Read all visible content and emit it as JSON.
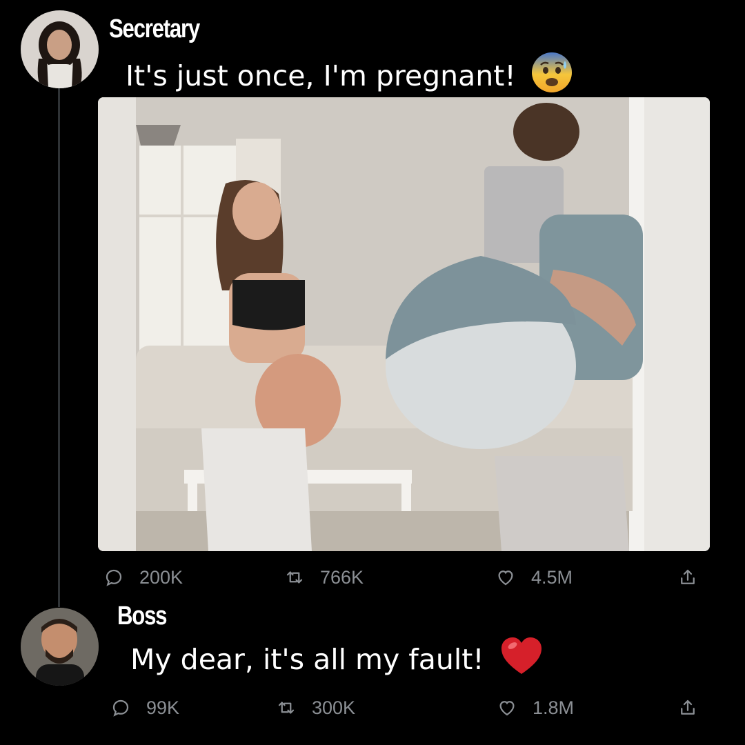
{
  "tweet1": {
    "author": "Secretary",
    "text": "It's just once, I'm pregnant!",
    "emoji_icon": "anxious-face-emoji-icon",
    "replies": "200K",
    "retweets": "766K",
    "likes": "4.5M"
  },
  "tweet2": {
    "author": "Boss",
    "text": "My dear, it's all my fault!",
    "emoji_icon": "red-heart-emoji-icon",
    "replies": "99K",
    "retweets": "300K",
    "likes": "1.8M"
  },
  "colors": {
    "background": "#000000",
    "text": "#ffffff",
    "action_gray": "#8b8f94",
    "heart_red": "#d6202a"
  }
}
